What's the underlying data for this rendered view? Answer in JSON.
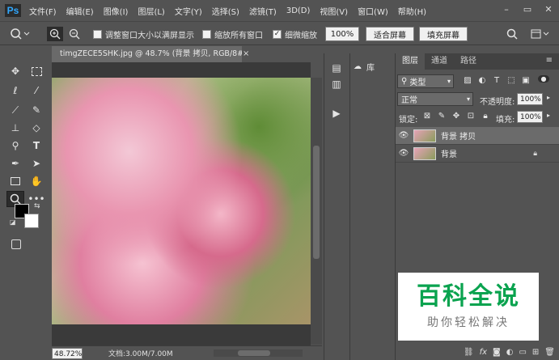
{
  "app": {
    "logo": "Ps"
  },
  "menu": [
    "文件(F)",
    "编辑(E)",
    "图像(I)",
    "图层(L)",
    "文字(Y)",
    "选择(S)",
    "滤镜(T)",
    "3D(D)",
    "视图(V)",
    "窗口(W)",
    "帮助(H)"
  ],
  "window_controls": {
    "minimize": "–",
    "restore": "▭",
    "close": "✕"
  },
  "options": {
    "resize_windows": "调整窗口大小以满屏显示",
    "zoom_all": "缩放所有窗口",
    "scrubby_zoom": "细微缩放",
    "scrubby_checked": true,
    "zoom_value": "100%",
    "fit_screen": "适合屏幕",
    "fill_screen": "填充屏幕"
  },
  "document": {
    "tab_title": "timgZECE5SHK.jpg @ 48.7% (背景 拷贝, RGB/8#) *",
    "tab_close": "×",
    "zoom": "48.72%",
    "info": "文档:3.00M/7.00M"
  },
  "panels": {
    "library": "库"
  },
  "layers_panel": {
    "tabs": [
      "图层",
      "通道",
      "路径"
    ],
    "filter_kind": "类型",
    "blend_mode": "正常",
    "opacity_label": "不透明度:",
    "opacity_value": "100%",
    "lock_label": "锁定:",
    "fill_label": "填充:",
    "fill_value": "100%",
    "layers": [
      {
        "name": "背景 拷贝",
        "selected": true,
        "locked": false
      },
      {
        "name": "背景",
        "selected": false,
        "locked": true
      }
    ],
    "footer_fx": "fx"
  },
  "watermark": {
    "title": "百科全说",
    "subtitle": "助你轻松解决"
  },
  "colors": {
    "ui_bg": "#535353",
    "tab_active": "#6a6a6a",
    "ps_blue": "#31a8ff",
    "watermark_green": "#0aa34f"
  }
}
